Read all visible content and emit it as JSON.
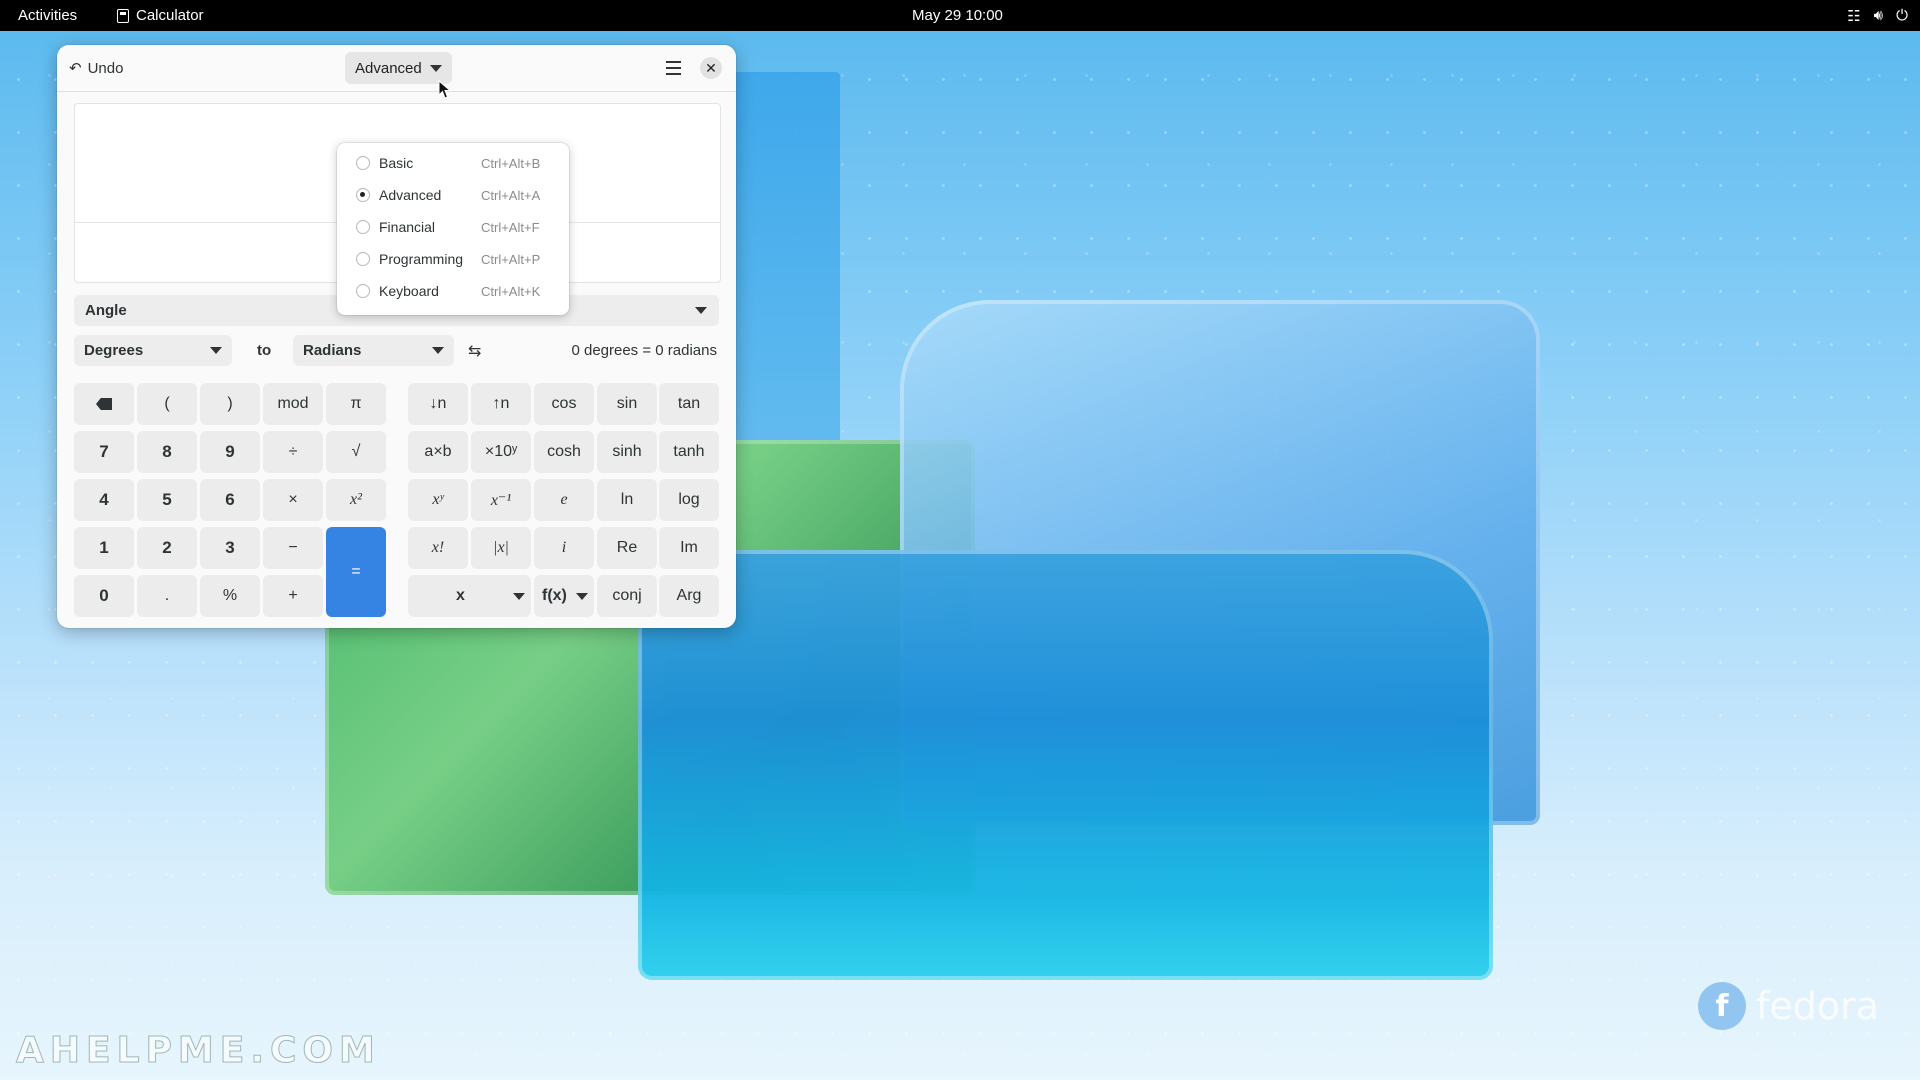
{
  "topbar": {
    "activities": "Activities",
    "app_name": "Calculator",
    "clock": "May 29  10:00",
    "tray": [
      "network-icon",
      "volume-icon",
      "power-icon"
    ]
  },
  "calculator": {
    "undo_label": "Undo",
    "mode_label": "Advanced",
    "menu_icon": "hamburger-icon",
    "close_icon": "close-icon",
    "conversion": {
      "category": "Angle",
      "from_unit": "Degrees",
      "to_label": "to",
      "to_unit": "Radians",
      "result": "0 degrees  =  0 radians"
    },
    "keys": {
      "backspace": "backspace-icon",
      "lparen": "(",
      "rparen": ")",
      "mod": "mod",
      "pi": "π",
      "down_n": "↓n",
      "up_n": "↑n",
      "cos": "cos",
      "sin": "sin",
      "tan": "tan",
      "k7": "7",
      "k8": "8",
      "k9": "9",
      "div": "÷",
      "sqrt": "√",
      "axb": "a×b",
      "x10y": "×10ʸ",
      "cosh": "cosh",
      "sinh": "sinh",
      "tanh": "tanh",
      "k4": "4",
      "k5": "5",
      "k6": "6",
      "mul": "×",
      "x2": "x²",
      "xy": "xʸ",
      "xinv": "x⁻¹",
      "e": "e",
      "ln": "ln",
      "log": "log",
      "k1": "1",
      "k2": "2",
      "k3": "3",
      "minus": "−",
      "eq": "=",
      "fact": "x!",
      "abs": "|x|",
      "i": "i",
      "re": "Re",
      "im": "Im",
      "k0": "0",
      "dot": ".",
      "pct": "%",
      "plus": "+",
      "var_x": "x",
      "fx": "f(x)",
      "conj": "conj",
      "arg": "Arg"
    }
  },
  "mode_menu": {
    "items": [
      {
        "label": "Basic",
        "shortcut": "Ctrl+Alt+B",
        "selected": false
      },
      {
        "label": "Advanced",
        "shortcut": "Ctrl+Alt+A",
        "selected": true
      },
      {
        "label": "Financial",
        "shortcut": "Ctrl+Alt+F",
        "selected": false
      },
      {
        "label": "Programming",
        "shortcut": "Ctrl+Alt+P",
        "selected": false
      },
      {
        "label": "Keyboard",
        "shortcut": "Ctrl+Alt+K",
        "selected": false
      }
    ]
  },
  "desktop": {
    "brand": "fedora",
    "watermark": "AHELPME.COM"
  }
}
